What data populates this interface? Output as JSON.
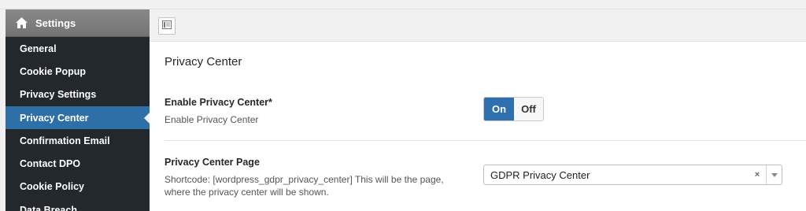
{
  "sidebar": {
    "title": "Settings",
    "home_icon": "home-icon",
    "items": [
      {
        "label": "General"
      },
      {
        "label": "Cookie Popup"
      },
      {
        "label": "Privacy Settings"
      },
      {
        "label": "Privacy Center",
        "active": true
      },
      {
        "label": "Confirmation Email"
      },
      {
        "label": "Contact DPO"
      },
      {
        "label": "Cookie Policy"
      },
      {
        "label": "Data Breach"
      }
    ]
  },
  "toolbar": {
    "layout_icon": "layout-panel-icon"
  },
  "main": {
    "section_title": "Privacy Center",
    "enable": {
      "label": "Enable Privacy Center*",
      "description": "Enable Privacy Center",
      "on_label": "On",
      "off_label": "Off",
      "value": "On"
    },
    "page": {
      "label": "Privacy Center Page",
      "description_line1": "Shortcode: [wordpress_gdpr_privacy_center] This will be the page,",
      "description_line2": "where the privacy center will be shown.",
      "selected": "GDPR Privacy Center",
      "clear_glyph": "×"
    }
  },
  "colors": {
    "sidebar_bg": "#23282d",
    "active_item": "#2e6fa8",
    "toggle_on": "#2e70ad"
  }
}
